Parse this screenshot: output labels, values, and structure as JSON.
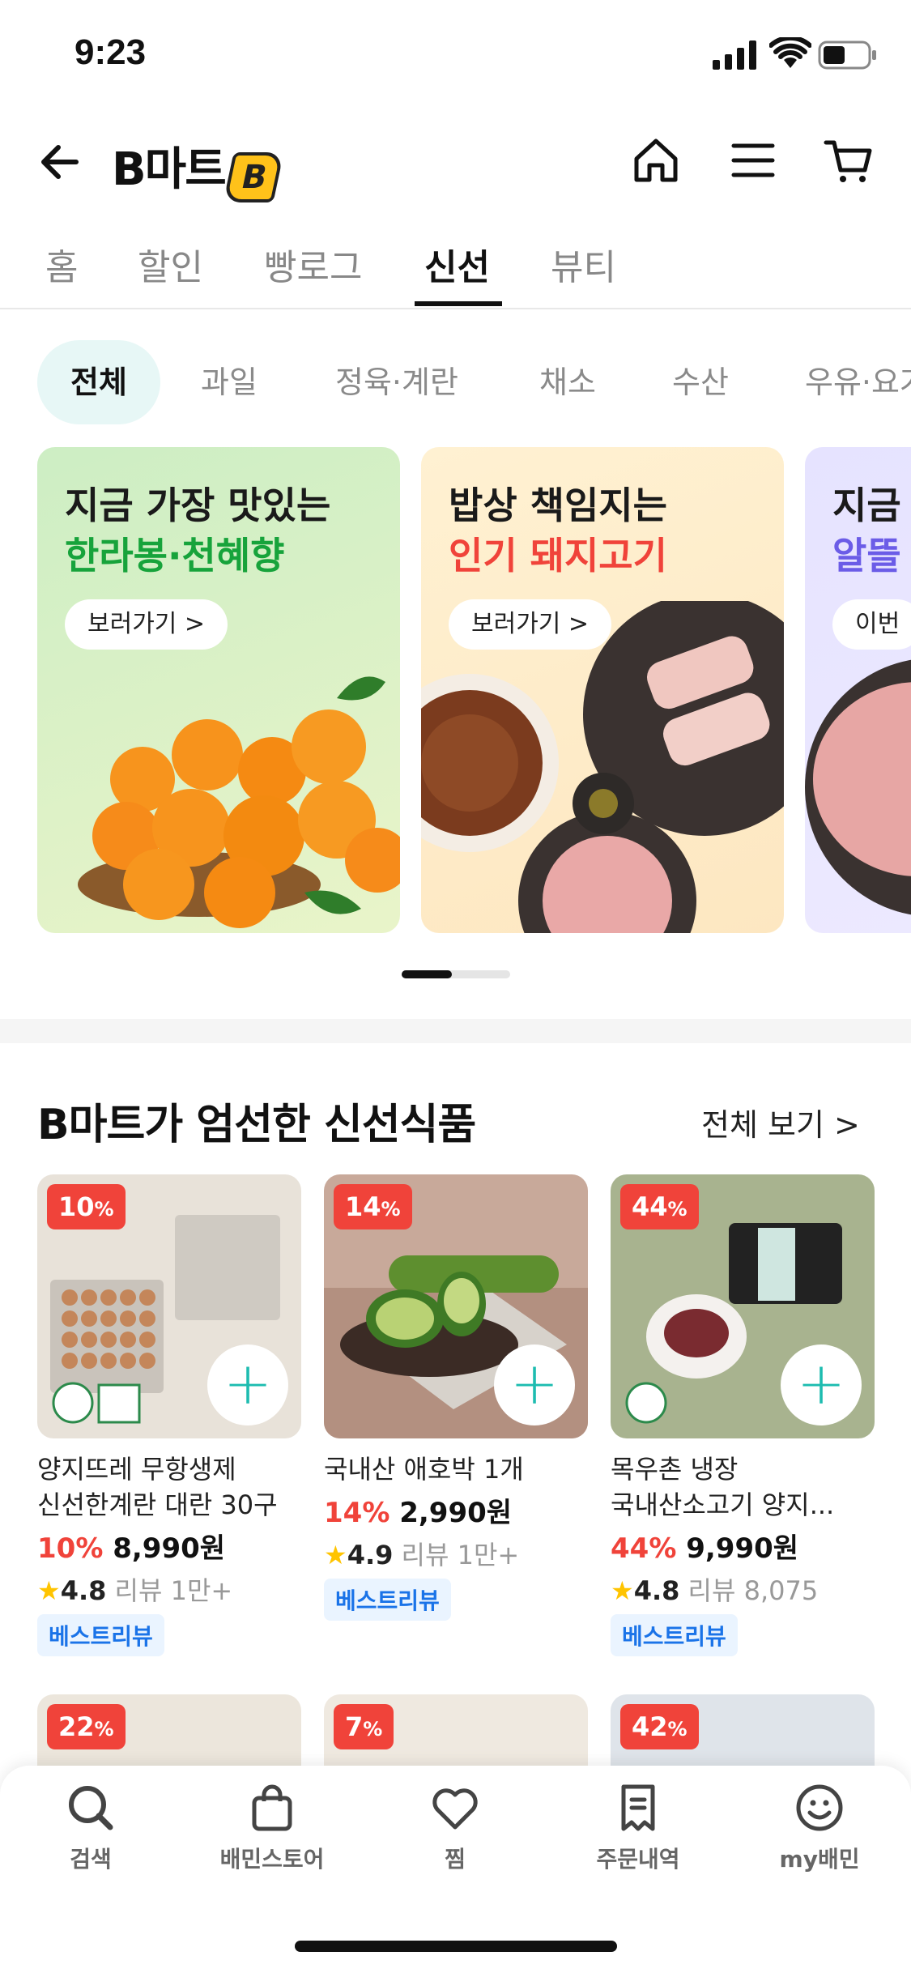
{
  "status_bar": {
    "time": "9:23"
  },
  "header": {
    "brand": "B마트",
    "brand_mark": "B"
  },
  "main_tabs": [
    {
      "label": "홈"
    },
    {
      "label": "할인"
    },
    {
      "label": "빵로그"
    },
    {
      "label": "신선",
      "active": true
    },
    {
      "label": "뷰티"
    }
  ],
  "chips": [
    {
      "label": "전체",
      "active": true
    },
    {
      "label": "과일"
    },
    {
      "label": "정육·계란"
    },
    {
      "label": "채소"
    },
    {
      "label": "수산"
    },
    {
      "label": "우유·요거"
    }
  ],
  "banners": [
    {
      "line1": "지금 가장 맛있는",
      "line2": "한라봉·천혜향",
      "line2_color": "#17a33b",
      "button": "보러가기 >"
    },
    {
      "line1": "밥상 책임지는",
      "line2": "인기 돼지고기",
      "line2_color": "#f0433a",
      "button": "보러가기 >"
    },
    {
      "line1": "지금",
      "line2": "알뜰",
      "line2_color": "#6b5ce7",
      "button": "이번"
    }
  ],
  "section": {
    "title": "B마트가 엄선한 신선식품",
    "see_all": "전체 보기 >"
  },
  "products": [
    {
      "badge_num": "10",
      "badge_pct": "%",
      "name1": "양지뜨레 무항생제",
      "name2": "신선한계란 대란 30구",
      "pct": "10%",
      "price": "8,990원",
      "rating": "4.8",
      "reviews": "리뷰 1만+",
      "tag": "베스트리뷰"
    },
    {
      "badge_num": "14",
      "badge_pct": "%",
      "name1": "국내산 애호박 1개",
      "name2": "",
      "pct": "14%",
      "price": "2,990원",
      "rating": "4.9",
      "reviews": "리뷰 1만+",
      "tag": "베스트리뷰"
    },
    {
      "badge_num": "44",
      "badge_pct": "%",
      "name1": "목우촌 냉장",
      "name2": "국내산소고기 양지...",
      "pct": "44%",
      "price": "9,990원",
      "rating": "4.8",
      "reviews": "리뷰 8,075",
      "tag": "베스트리뷰"
    }
  ],
  "products_row2": [
    {
      "badge_num": "22",
      "badge_pct": "%"
    },
    {
      "badge_num": "7",
      "badge_pct": "%"
    },
    {
      "badge_num": "42",
      "badge_pct": "%"
    }
  ],
  "bottom_nav": [
    {
      "label": "검색",
      "icon": "search-icon"
    },
    {
      "label": "배민스토어",
      "icon": "shopping-bag-icon"
    },
    {
      "label": "찜",
      "icon": "heart-icon"
    },
    {
      "label": "주문내역",
      "icon": "receipt-icon"
    },
    {
      "label": "my배민",
      "icon": "smile-face-icon"
    }
  ],
  "colors": {
    "accent_mint": "#1dbcb0",
    "sale_red": "#f0433a",
    "tag_blue": "#1a73e8"
  }
}
